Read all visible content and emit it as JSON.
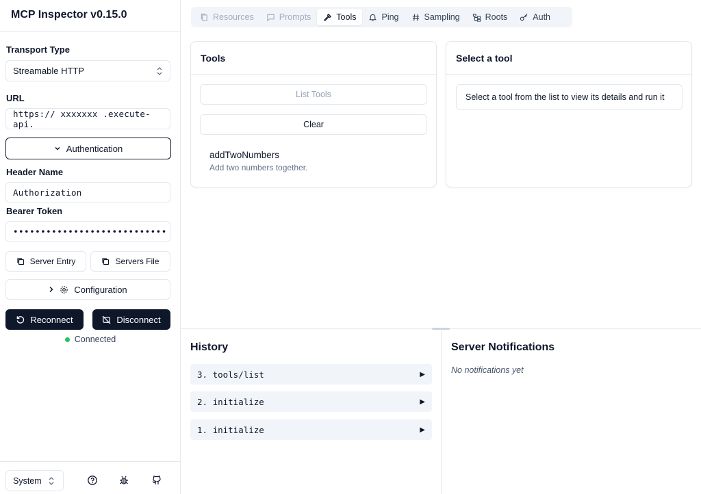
{
  "app": {
    "title": "MCP Inspector v0.15.0"
  },
  "sidebar": {
    "transport_label": "Transport Type",
    "transport_value": "Streamable HTTP",
    "url_label": "URL",
    "url_value": "https://  xxxxxxx  .execute-api.",
    "auth_button": "Authentication",
    "header_name_label": "Header Name",
    "header_name_value": "Authorization",
    "bearer_label": "Bearer Token",
    "bearer_value": "••••••••••••••••••••••••••••",
    "server_entry": "Server Entry",
    "servers_file": "Servers File",
    "configuration": "Configuration",
    "reconnect": "Reconnect",
    "disconnect": "Disconnect",
    "status": "Connected",
    "theme": "System"
  },
  "tabs": [
    {
      "label": "Resources",
      "icon": "files-icon"
    },
    {
      "label": "Prompts",
      "icon": "message-icon"
    },
    {
      "label": "Tools",
      "icon": "hammer-icon"
    },
    {
      "label": "Ping",
      "icon": "bell-icon"
    },
    {
      "label": "Sampling",
      "icon": "hash-icon"
    },
    {
      "label": "Roots",
      "icon": "folder-tree-icon"
    },
    {
      "label": "Auth",
      "icon": "key-icon"
    }
  ],
  "tools_card": {
    "title": "Tools",
    "list_button": "List Tools",
    "clear_button": "Clear",
    "items": [
      {
        "name": "addTwoNumbers",
        "description": "Add two numbers together."
      }
    ]
  },
  "select_card": {
    "title": "Select a tool",
    "hint": "Select a tool from the list to view its details and run it"
  },
  "history": {
    "title": "History",
    "items": [
      "3. tools/list",
      "2. initialize",
      "1. initialize"
    ]
  },
  "notifications": {
    "title": "Server Notifications",
    "empty": "No notifications yet"
  },
  "colors": {
    "primary_dark": "#0f172a",
    "status_green": "#22c55e",
    "muted_bg": "#f1f5f9"
  }
}
